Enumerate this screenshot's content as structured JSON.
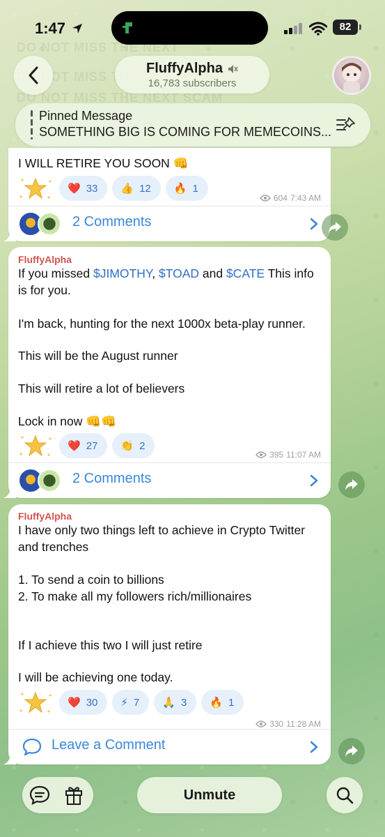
{
  "status_bar": {
    "time": "1:47",
    "battery": "82"
  },
  "header": {
    "channel_name": "FluffyAlpha",
    "subscribers": "16,783 subscribers"
  },
  "pinned": {
    "title": "Pinned Message",
    "text": "SOMETHING BIG IS COMING FOR MEMECOINS..."
  },
  "messages": [
    {
      "lines": [
        "I WILL RETIRE YOU SOON 👊"
      ],
      "reactions": [
        {
          "emoji": "❤️",
          "count": "33"
        },
        {
          "emoji": "👍",
          "count": "12"
        },
        {
          "emoji": "🔥",
          "count": "1"
        }
      ],
      "views": "604",
      "time": "7:43 AM",
      "comments": "2 Comments"
    },
    {
      "sender": "FluffyAlpha",
      "line1_pre": "If you missed ",
      "tag1": "$JIMOTHY",
      "sep1": ", ",
      "tag2": "$TOAD",
      "sep2": " and ",
      "tag3": "$CATE",
      "line1_post": " This info",
      "lines": [
        "is for you.",
        "I'm back, hunting for the next 1000x beta-play runner.",
        "This will be the August runner",
        "This will retire a lot of believers",
        "Lock in now 👊👊"
      ],
      "reactions": [
        {
          "emoji": "❤️",
          "count": "27"
        },
        {
          "emoji": "👏",
          "count": "2"
        }
      ],
      "views": "395",
      "time": "11:07 AM",
      "comments": "2 Comments"
    },
    {
      "sender": "FluffyAlpha",
      "lines": [
        "I have only two things left to achieve in Crypto Twitter",
        "and trenches",
        "1. To send a coin to billions",
        "2. To make all my followers rich/millionaires",
        "If I achieve this two I will just retire",
        "I will be achieving one today."
      ],
      "reactions": [
        {
          "emoji": "❤️",
          "count": "30"
        },
        {
          "emoji": "⚡",
          "count": "7"
        },
        {
          "emoji": "🙏",
          "count": "3"
        },
        {
          "emoji": "🔥",
          "count": "1"
        }
      ],
      "views": "330",
      "time": "11:28 AM",
      "comments": "Leave a Comment"
    }
  ],
  "bottom": {
    "unmute": "Unmute"
  },
  "colors": {
    "link": "#2e6fc4",
    "accent": "#3a86d8",
    "sender": "#d0534e"
  },
  "background_text": [
    "DO NOT MISS THE NEXT",
    "DO NOT MISS THE",
    "DO NOT MISS THE NEXT SCAM"
  ]
}
